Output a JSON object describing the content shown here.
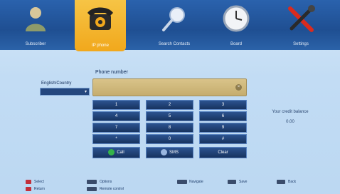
{
  "tabs": [
    {
      "id": "subscriber",
      "label": "Subscriber",
      "icon": "person-icon"
    },
    {
      "id": "phone",
      "label": "IP phone",
      "icon": "telephone-icon",
      "selected": true
    },
    {
      "id": "search",
      "label": "Search Contacts",
      "icon": "magnifier-icon"
    },
    {
      "id": "board",
      "label": "Board",
      "icon": "clock-icon"
    },
    {
      "id": "settings",
      "label": "Settings",
      "icon": "tools-icon"
    }
  ],
  "dialer": {
    "phone_label": "Phone number",
    "country_label": "English/Country",
    "country_value": "",
    "phone_value": ""
  },
  "keypad": {
    "rows": [
      [
        "1",
        "2",
        "3"
      ],
      [
        "4",
        "5",
        "6"
      ],
      [
        "7",
        "8",
        "9"
      ],
      [
        "*",
        "0",
        "#"
      ]
    ],
    "call_label": "Call",
    "sms_label": "SMS",
    "clear_label": "Clear"
  },
  "credit": {
    "label": "Your credit balance",
    "value": "0.00"
  },
  "footer": {
    "select": "Select",
    "options": "Options",
    "navigate": "Navigate",
    "save": "Save",
    "back": "Back",
    "return_label": "Return",
    "remote": "Remote",
    "remote_hint": "Remote control"
  },
  "colors": {
    "topbar": "#1f4f92",
    "selected_tab": "#f1a81c",
    "key_bg": "#17335f",
    "input_bg": "#c5ad6e",
    "call": "#34b34a"
  }
}
